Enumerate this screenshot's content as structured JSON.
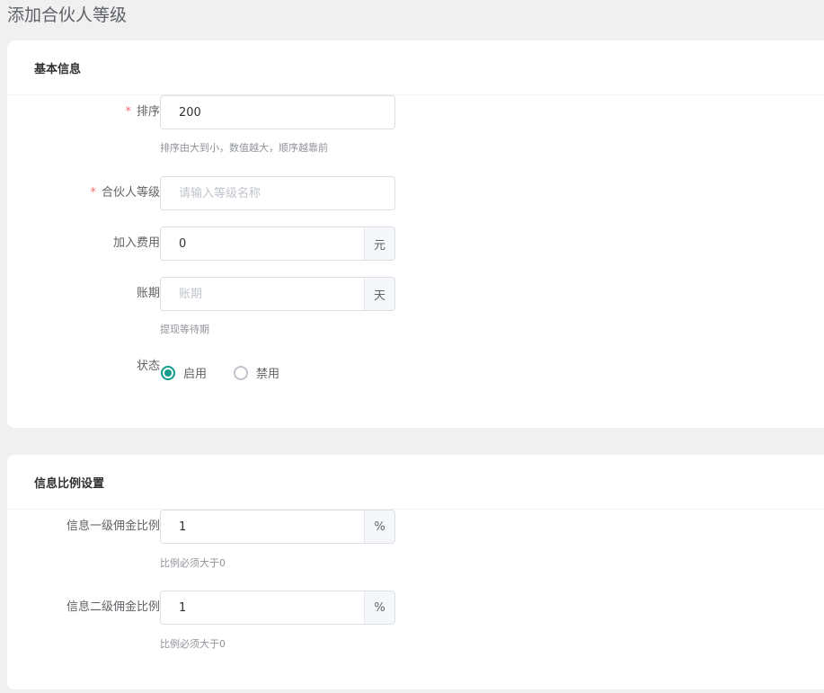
{
  "page_title": "添加合伙人等级",
  "basic": {
    "header": "基本信息",
    "sort": {
      "label": "排序",
      "value": "200",
      "help": "排序由大到小，数值越大，顺序越靠前"
    },
    "level": {
      "label": "合伙人等级",
      "placeholder": "请输入等级名称"
    },
    "fee": {
      "label": "加入费用",
      "value": "0",
      "unit": "元"
    },
    "period": {
      "label": "账期",
      "placeholder": "账期",
      "unit": "天",
      "help": "提现等待期"
    },
    "status": {
      "label": "状态",
      "options": [
        "启用",
        "禁用"
      ],
      "selected": "启用"
    }
  },
  "ratio": {
    "header": "信息比例设置",
    "level1": {
      "label": "信息一级佣金比例",
      "value": "1",
      "unit": "%",
      "help": "比例必须大于0"
    },
    "level2": {
      "label": "信息二级佣金比例",
      "value": "1",
      "unit": "%",
      "help": "比例必须大于0"
    }
  },
  "colors": {
    "primary": "#0f9c8a",
    "required": "#f56c6c"
  }
}
